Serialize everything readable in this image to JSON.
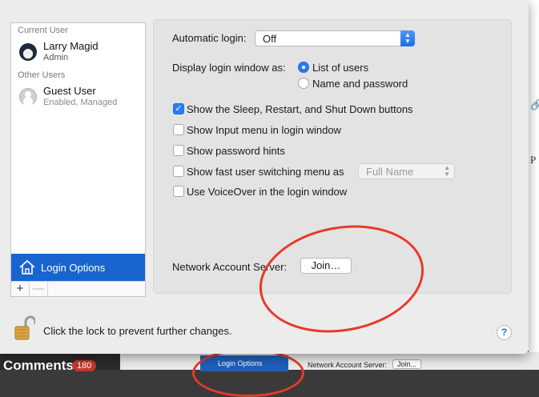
{
  "sidebar": {
    "current_user_header": "Current User",
    "current_user": {
      "name": "Larry Magid",
      "role": "Admin"
    },
    "other_users_header": "Other Users",
    "guest_user": {
      "name": "Guest User",
      "status": "Enabled, Managed"
    },
    "login_options_label": "Login Options",
    "add_label": "+",
    "remove_label": "—"
  },
  "panel": {
    "automatic_login_label": "Automatic login:",
    "automatic_login_value": "Off",
    "display_login_label": "Display login window as:",
    "radio_list_of_users": "List of users",
    "radio_name_password": "Name and password",
    "selected_display": "List of users",
    "checkboxes": [
      {
        "label": "Show the Sleep, Restart, and Shut Down buttons",
        "checked": true
      },
      {
        "label": "Show Input menu in login window",
        "checked": false
      },
      {
        "label": "Show password hints",
        "checked": false
      },
      {
        "label": "Show fast user switching menu as",
        "checked": false
      },
      {
        "label": "Use VoiceOver in the login window",
        "checked": false
      }
    ],
    "fast_switching_value": "Full Name",
    "network_server_label": "Network Account Server:",
    "join_button": "Join…"
  },
  "footer": {
    "lock_text": "Click the lock to prevent further changes.",
    "help_label": "?"
  },
  "background": {
    "comments_label": "Comments",
    "comments_count": "180",
    "thumb_login_options": "Login Options",
    "thumb_network_label": "Network Account Server:",
    "thumb_join": "Join...",
    "side_p": "P"
  },
  "colors": {
    "accent": "#1a64d0",
    "annotation_red": "#e8392b"
  }
}
